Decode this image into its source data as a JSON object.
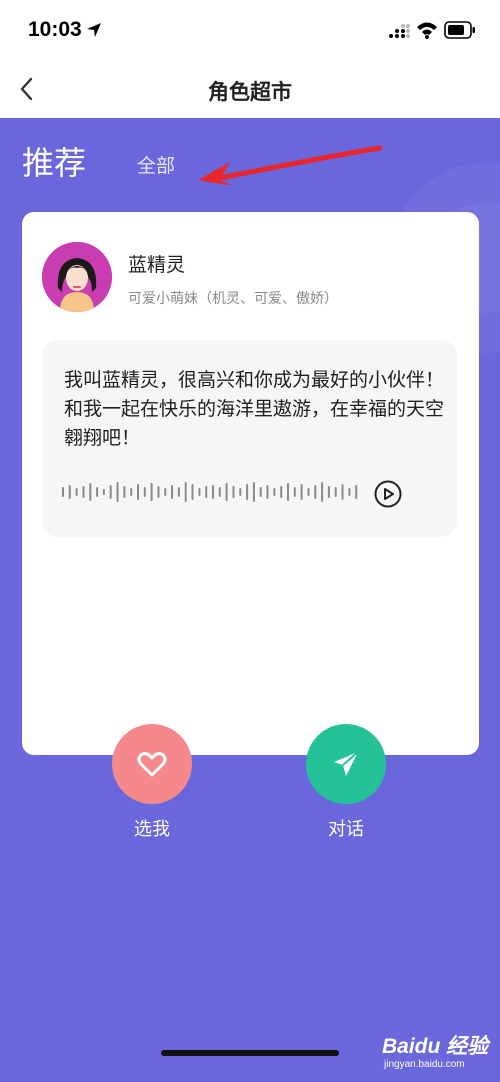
{
  "status_bar": {
    "time": "10:03"
  },
  "nav": {
    "title": "角色超市"
  },
  "tabs": {
    "recommend": "推荐",
    "all": "全部"
  },
  "character": {
    "name": "蓝精灵",
    "description": "可爱小萌妹（机灵、可爱、傲娇）",
    "intro": "我叫蓝精灵，很高兴和你成为最好的小伙伴！和我一起在快乐的海洋里遨游，在幸福的天空翱翔吧！"
  },
  "actions": {
    "like_label": "选我",
    "chat_label": "对话"
  },
  "watermark": {
    "brand": "Baidu 经验",
    "site": "jingyan.baidu.com"
  },
  "colors": {
    "background": "#6a66dc",
    "like_button": "#f4888a",
    "chat_button": "#25c29a",
    "annotation_arrow": "#e8262c"
  },
  "icons": [
    "location-arrow-icon",
    "signal-icon",
    "wifi-icon",
    "battery-icon",
    "back-chevron-icon",
    "play-icon",
    "heart-icon",
    "paper-plane-icon"
  ]
}
